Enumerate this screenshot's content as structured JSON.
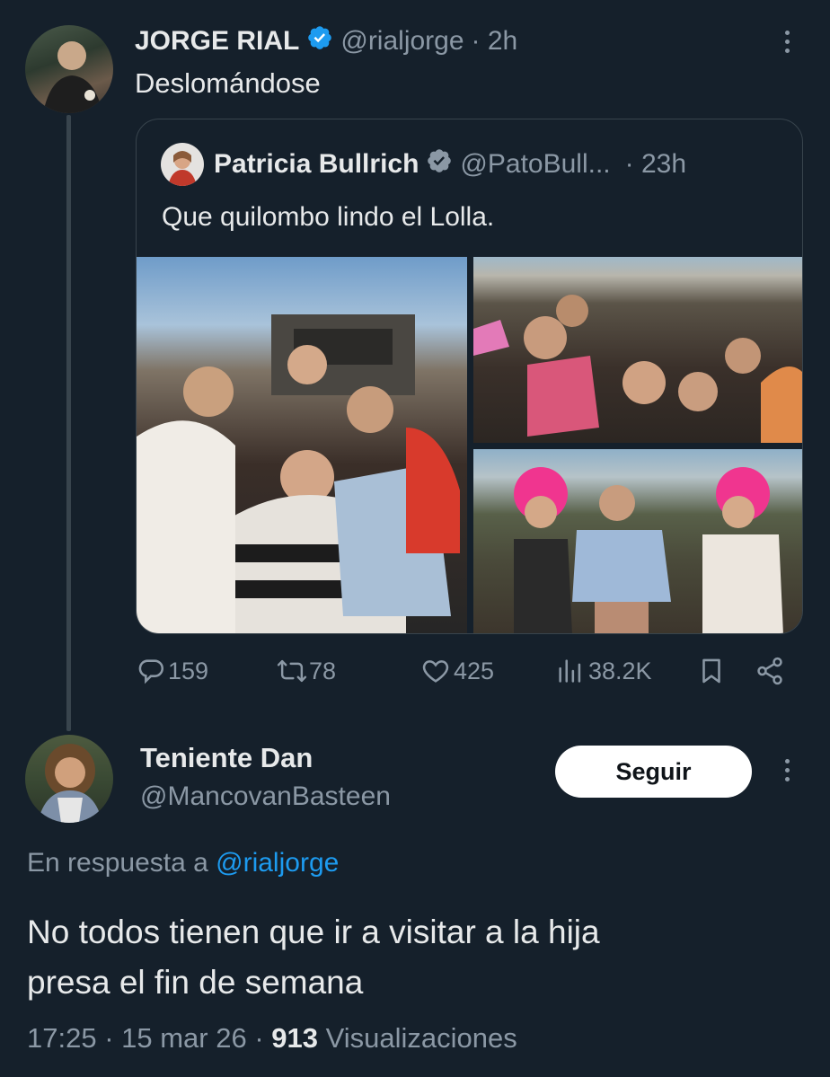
{
  "original_tweet": {
    "display_name": "JORGE RIAL",
    "handle": "@rialjorge",
    "time": "· 2h",
    "text": "Deslomándose"
  },
  "quoted_tweet": {
    "display_name": "Patricia Bullrich",
    "handle": "@PatoBull...",
    "time": "· 23h",
    "text": "Que quilombo lindo el Lolla."
  },
  "actions": {
    "replies": "159",
    "retweets": "78",
    "likes": "425",
    "views": "38.2K"
  },
  "reply": {
    "display_name": "Teniente Dan",
    "handle": "@MancovanBasteen",
    "follow_label": "Seguir",
    "replying_to_prefix": "En respuesta a",
    "replying_to_handle": "@rialjorge",
    "text_line1": "No todos tienen que ir a visitar a la hija",
    "text_line2": "presa el fin de semana",
    "timestamp": "17:25 · 15 mar 26 ·",
    "views_count": "913",
    "views_label": "Visualizaciones"
  },
  "colors": {
    "background": "#15202b",
    "text": "#e7e9ea",
    "muted": "#8b98a5",
    "link": "#1d9bf0",
    "verified": "#1d9bf0",
    "border": "#38444d"
  },
  "icons": [
    "verified-badge-icon",
    "more-options-icon",
    "reply-icon",
    "retweet-icon",
    "like-icon",
    "views-icon",
    "bookmark-icon",
    "share-icon"
  ]
}
